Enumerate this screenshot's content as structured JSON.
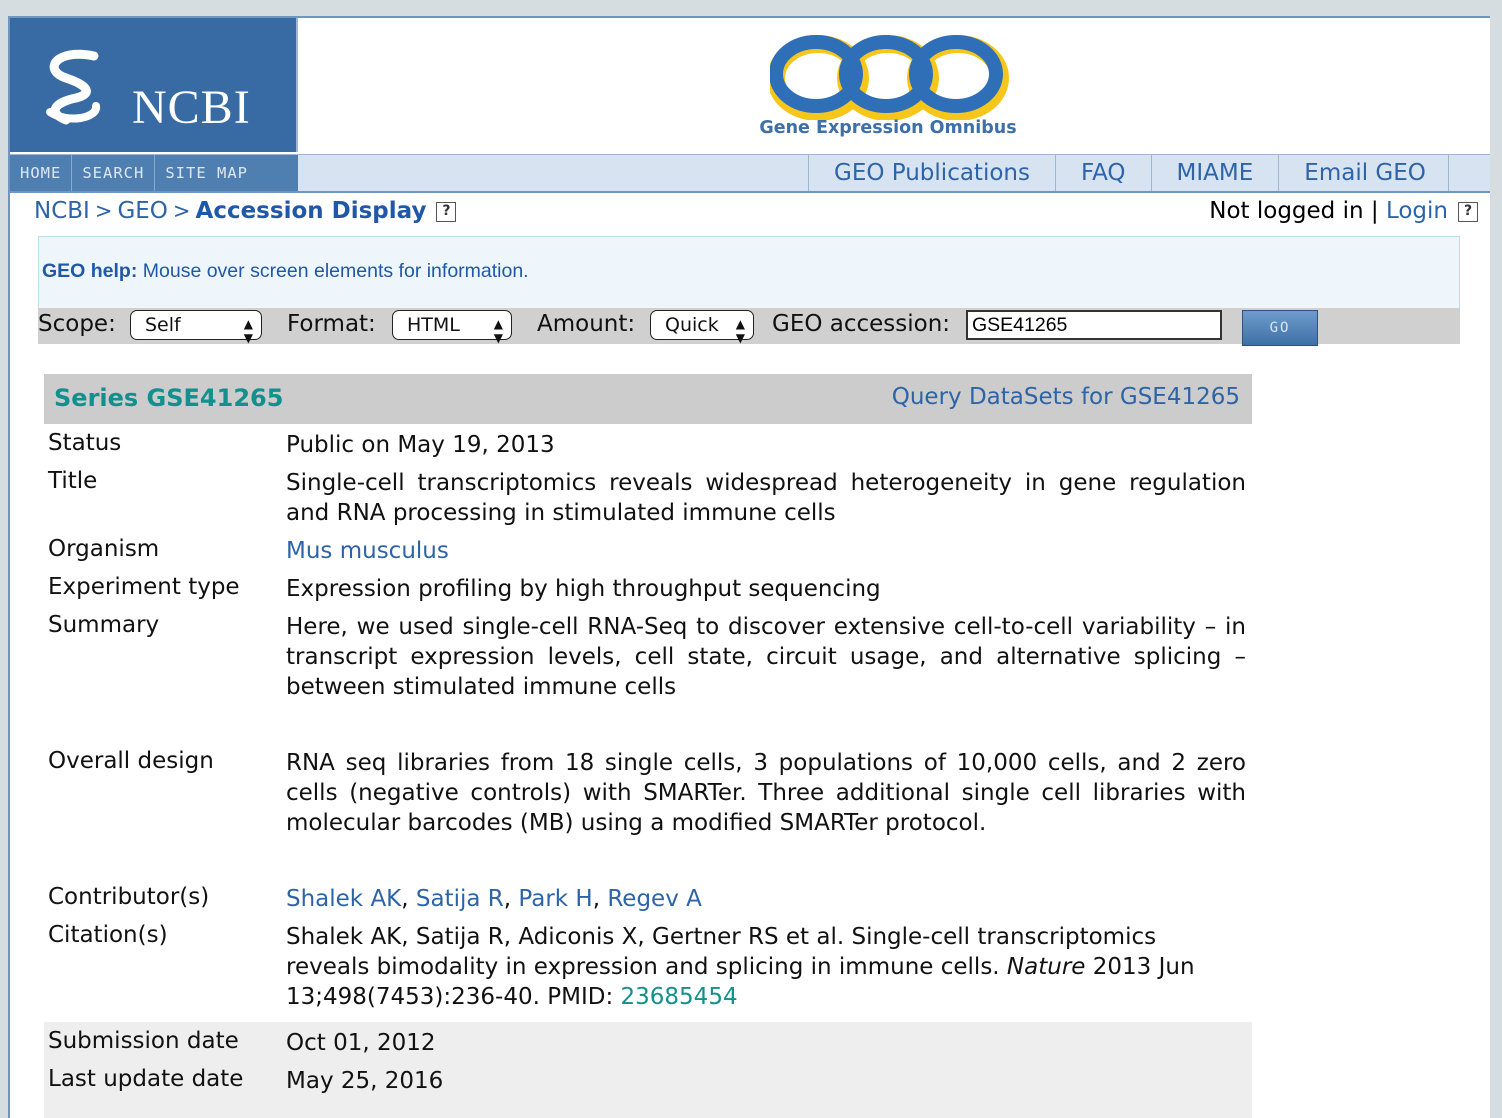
{
  "header": {
    "ncbi_label": "NCBI",
    "geo_title": "GEO",
    "geo_subtitle": "Gene Expression Omnibus"
  },
  "left_nav": [
    "HOME",
    "SEARCH",
    "SITE MAP"
  ],
  "right_nav": [
    "GEO Publications",
    "FAQ",
    "MIAME",
    "Email GEO"
  ],
  "breadcrumb": {
    "ncbi": "NCBI",
    "geo": "GEO",
    "sep": ">",
    "current": "Accession Display"
  },
  "login": {
    "status": "Not logged in",
    "sep": "|",
    "login_link": "Login"
  },
  "help": {
    "label": "GEO help:",
    "text": "Mouse over screen elements for information."
  },
  "controls": {
    "scope_label": "Scope:",
    "scope_value": "Self",
    "format_label": "Format:",
    "format_value": "HTML",
    "amount_label": "Amount:",
    "amount_value": "Quick",
    "accession_label": "GEO accession:",
    "accession_value": "GSE41265",
    "go_label": "GO"
  },
  "series": {
    "title": "Series GSE41265",
    "query_link": "Query DataSets for GSE41265",
    "status_label": "Status",
    "status": "Public on May 19, 2013",
    "title_label": "Title",
    "title_text": "Single-cell transcriptomics reveals widespread heterogeneity in gene regulation and RNA processing in stimulated immune cells",
    "organism_label": "Organism",
    "organism": "Mus musculus",
    "experiment_label": "Experiment type",
    "experiment": "Expression profiling by high throughput sequencing",
    "summary_label": "Summary",
    "summary": "Here, we used single-cell RNA-Seq to discover extensive cell-to-cell variability – in transcript expression levels, cell state, circuit usage, and alternative splicing – between stimulated immune cells",
    "design_label": "Overall design",
    "design": "RNA seq libraries from 18 single cells, 3 populations of 10,000 cells, and 2 zero cells (negative controls) with SMARTer. Three additional single cell libraries with molecular barcodes (MB) using a modified SMARTer protocol.",
    "contributors_label": "Contributor(s)",
    "contributors": [
      "Shalek AK",
      "Satija R",
      "Park H",
      "Regev A"
    ],
    "citation_label": "Citation(s)",
    "citation_pre": "Shalek AK, Satija R, Adiconis X, Gertner RS et al. Single-cell transcriptomics reveals bimodality in expression and splicing in immune cells.",
    "citation_journal": "Nature",
    "citation_post": "2013 Jun 13;498(7453):236-40. PMID:",
    "citation_pmid": "23685454",
    "submission_label": "Submission date",
    "submission": "Oct 01, 2012",
    "update_label": "Last update date",
    "update": "May 25, 2016"
  },
  "colors": {
    "link": "#2d64a8",
    "teal": "#12908e",
    "ncbi_blue": "#386ba3"
  }
}
